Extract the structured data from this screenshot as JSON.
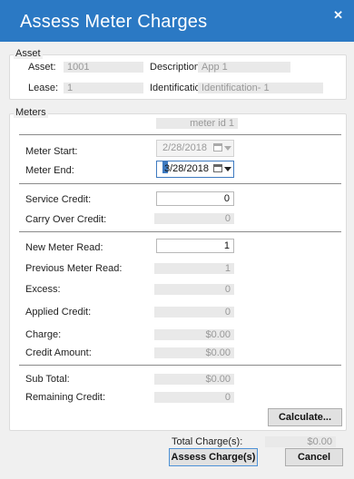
{
  "window": {
    "title": "Assess Meter Charges",
    "close_icon": "✕"
  },
  "asset": {
    "legend": "Asset",
    "asset_label": "Asset:",
    "asset_value": "1001",
    "description_label": "Description:",
    "description_value": "App 1",
    "lease_label": "Lease:",
    "lease_value": "1",
    "identification_label": "Identification:",
    "identification_value": "Identification- 1"
  },
  "meters": {
    "legend": "Meters",
    "meter_id": "meter id 1",
    "meter_start_label": "Meter Start:",
    "meter_start_value": "2/28/2018",
    "meter_end_label": "Meter End:",
    "meter_end_value": "3/28/2018",
    "service_credit_label": "Service Credit:",
    "service_credit_value": "0",
    "carry_over_credit_label": "Carry Over Credit:",
    "carry_over_credit_value": "0",
    "new_meter_read_label": "New Meter Read:",
    "new_meter_read_value": "1",
    "previous_meter_read_label": "Previous Meter Read:",
    "previous_meter_read_value": "1",
    "excess_label": "Excess:",
    "excess_value": "0",
    "applied_credit_label": "Applied Credit:",
    "applied_credit_value": "0",
    "charge_label": "Charge:",
    "charge_value": "$0.00",
    "credit_amount_label": "Credit Amount:",
    "credit_amount_value": "$0.00",
    "sub_total_label": "Sub Total:",
    "sub_total_value": "$0.00",
    "remaining_credit_label": "Remaining Credit:",
    "remaining_credit_value": "0",
    "calculate_label": "Calculate..."
  },
  "footer": {
    "total_charges_label": "Total Charge(s):",
    "total_charges_value": "$0.00",
    "assess_label": "Assess Charge(s)",
    "cancel_label": "Cancel"
  },
  "colors": {
    "titlebar": "#2b79c4",
    "accent": "#3e7ac0"
  }
}
